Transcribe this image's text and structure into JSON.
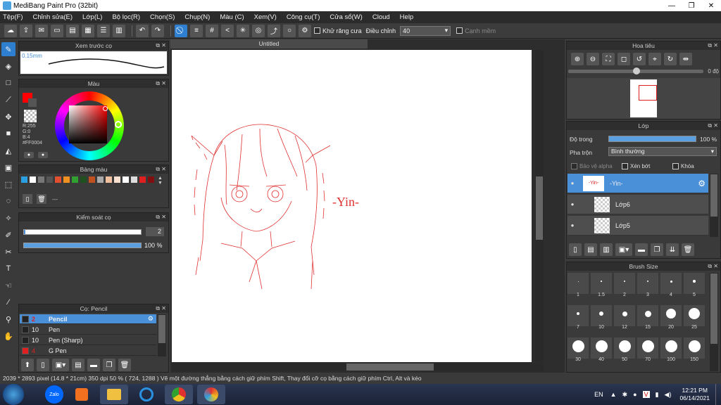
{
  "window": {
    "title": "MediBang Paint Pro (32bit)",
    "minimize": "—",
    "maximize": "❐",
    "close": "✕"
  },
  "menu": [
    "Tệp(F)",
    "Chỉnh sửa(E)",
    "Lớp(L)",
    "Bộ lọc(R)",
    "Chọn(S)",
    "Chụp(N)",
    "Màu (C)",
    "Xem(V)",
    "Công cụ(T)",
    "Cửa sổ(W)",
    "Cloud",
    "Help"
  ],
  "toolbar": {
    "antialias_label": "Khử răng cưa",
    "adjust_label": "Điều chỉnh",
    "adjust_value": "40",
    "edge_label": "Cạnh mềm"
  },
  "brush_preview": {
    "title": "Xem trước cọ",
    "size": "0.15mm"
  },
  "color_panel": {
    "title": "Màu",
    "r": "R:255",
    "g": "G:0",
    "b": "B:4",
    "hex": "#FF0004",
    "primary_color": "#ff0004"
  },
  "palette": {
    "title": "Bảng màu",
    "colors": [
      "#2aa0e0",
      "#ffffff",
      "#777777",
      "#555555",
      "#e05030",
      "#f09020",
      "#30a030",
      "#205020",
      "#c05020",
      "#aaaaaa",
      "#f0c0a0",
      "#f8e0d0",
      "#ffffff",
      "#dddddd",
      "#e02020",
      "#801010"
    ],
    "more": "---"
  },
  "brush_control": {
    "title": "Kiểm soát cọ",
    "size_value": "2",
    "opacity_value": "100 %",
    "opacity_fraction": 1.0
  },
  "brush_list": {
    "title": "Cọ: Pencil",
    "items": [
      {
        "num": "2",
        "name": "Pencil",
        "color": "#ffffff"
      },
      {
        "num": "10",
        "name": "Pen",
        "color": "#222222"
      },
      {
        "num": "10",
        "name": "Pen (Sharp)",
        "color": "#222222"
      },
      {
        "num": "4",
        "name": "G Pen",
        "color": "#e02020"
      }
    ]
  },
  "canvas": {
    "tab": "Untitled",
    "text": "-Yin-"
  },
  "navigator": {
    "title": "Hoa tiêu",
    "angle": "0 độ"
  },
  "layer_panel": {
    "title": "Lớp",
    "opacity_label": "Độ trong",
    "opacity_value": "100 %",
    "blend_label": "Pha trộn",
    "blend_value": "Bình thường",
    "protect_alpha": "Bảo vệ alpha",
    "clipping": "Xén bớt",
    "lock": "Khóa",
    "layers": [
      {
        "name": "-Yin-",
        "thumb": "-Yin-"
      },
      {
        "name": "Lớp6",
        "thumb": ""
      },
      {
        "name": "Lớp5",
        "thumb": ""
      }
    ]
  },
  "brush_size": {
    "title": "Brush Size",
    "sizes": [
      "1",
      "1.5",
      "2",
      "3",
      "4",
      "5",
      "7",
      "10",
      "12",
      "15",
      "20",
      "25",
      "30",
      "40",
      "50",
      "70",
      "100",
      "150"
    ]
  },
  "status": {
    "text": "2039 * 2893 pixel   (14.8 * 21cm)   350 dpi   50 %   ( 724, 1288 )   Vẽ một đường thẳng bằng cách giữ phím Shift, Thay đổi cỡ cọ bằng cách giữ phím Ctrl, Alt và kéo"
  },
  "taskbar": {
    "apps": [
      "Zalo"
    ],
    "lang": "EN",
    "time": "12:21 PM",
    "date": "06/14/2021"
  }
}
